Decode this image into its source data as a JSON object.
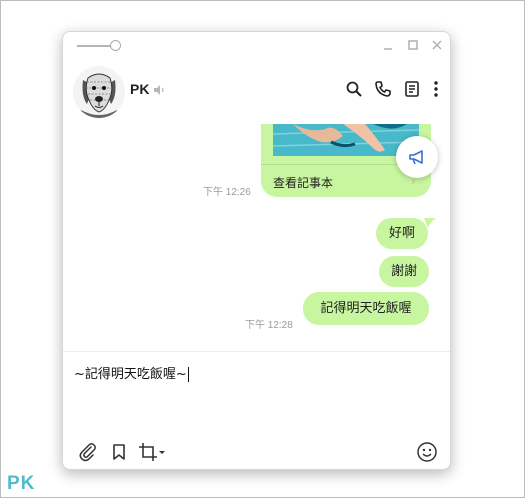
{
  "header": {
    "contact_name": "PK"
  },
  "messages": {
    "note": {
      "label": "查看記事本",
      "time": "下午 12:26"
    },
    "bubbles": [
      {
        "text": "好啊"
      },
      {
        "text": "謝謝"
      },
      {
        "text": "記得明天吃飯喔",
        "time": "下午 12:28"
      }
    ]
  },
  "composer": {
    "draft_text": "~記得明天吃飯喔~"
  },
  "watermark": {
    "text": "PK"
  },
  "colors": {
    "bubble_green": "#c7f5a0",
    "megaphone_blue": "#3b6fd8",
    "watermark_teal": "#53b9cf"
  },
  "icons": {
    "window": [
      "opacity-slider",
      "minimize-icon",
      "maximize-icon",
      "close-icon"
    ],
    "header": [
      "mute-speaker-icon",
      "search-icon",
      "phone-icon",
      "notes-icon",
      "more-icon"
    ],
    "toolbar": [
      "paperclip-icon",
      "bookmark-icon",
      "crop-screenshot-icon",
      "emoji-icon"
    ]
  }
}
